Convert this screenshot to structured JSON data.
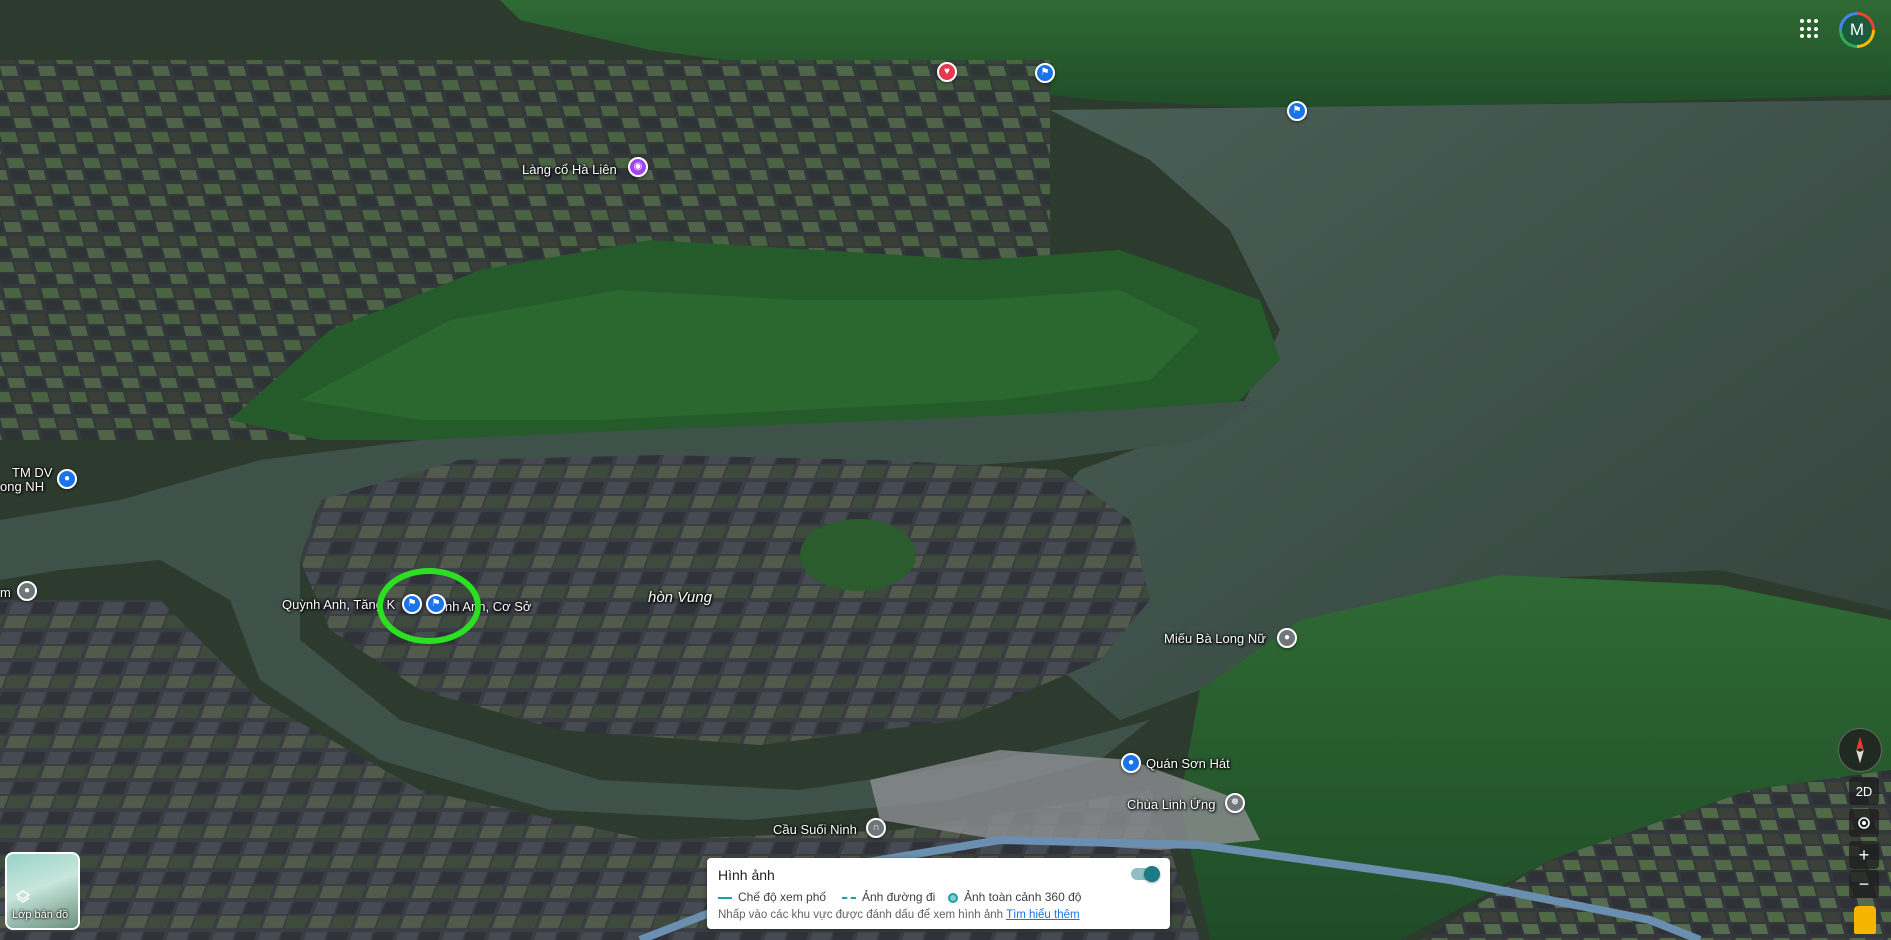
{
  "map": {
    "labels": {
      "lang_co_ha_lien": "Làng cổ Hà Liên",
      "tm_dv": "TM DV",
      "ong_nh": "ong NH",
      "quynh_anh_tang": "Quỳnh Anh, Tăng K",
      "quynh_anh_co_so": "nh Anh, Cơ Sở",
      "hon_vung": "hòn Vung",
      "mieu_ba_long_nu": "Miếu Bà Long Nữ",
      "quan_son_hat": "Quán Sơn Hát",
      "chua_linh_ung": "Chùa Linh Ứng",
      "cau_suoi_ninh": "Cầu Suối Ninh",
      "edge_m": "m"
    },
    "pins": {
      "red": "heart-icon",
      "blue": "flag-icon",
      "purple": "camera-icon",
      "gray": "pin-icon"
    },
    "highlight_color": "#2be020"
  },
  "header": {
    "avatar_initial": "M"
  },
  "layers": {
    "label": "Lớp bản đồ"
  },
  "imagery_panel": {
    "title": "Hình ảnh",
    "legend_street": "Chế độ xem phố",
    "legend_road": "Ảnh đường đi",
    "legend_360": "Ảnh toàn cảnh 360 độ",
    "hint": "Nhấp vào các khu vực được đánh dấu để xem hình ảnh",
    "learn_more": "Tìm hiểu thêm",
    "toggle_on": true
  },
  "controls": {
    "view_2d": "2D",
    "zoom_in": "+",
    "zoom_out": "−"
  }
}
